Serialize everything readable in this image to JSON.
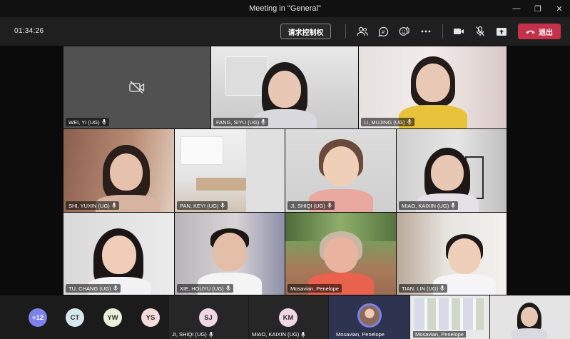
{
  "window": {
    "title": "Meeting in \"General\""
  },
  "toolbar": {
    "timer": "01:34:26",
    "request_control_label": "请求控制权",
    "leave_label": "退出"
  },
  "colors": {
    "leave": "#c4314b",
    "background": "#1f1f1f",
    "avatar_purple": "#7b83eb"
  },
  "participants": [
    {
      "name": "WEI, YI (UG)"
    },
    {
      "name": "FANG, SIYU (UG)"
    },
    {
      "name": "LI, MUJING (UG)"
    },
    {
      "name": "SHI, YUXIN (UG)"
    },
    {
      "name": "PAN, KEYI (UG)"
    },
    {
      "name": "JI, SHIQI (UG)"
    },
    {
      "name": "MIAO, KAIXIN (UG)"
    },
    {
      "name": "TU, CHANG (UG)"
    },
    {
      "name": "XIE, HOUYU (UG)"
    },
    {
      "name": "Mosavian, Penelope"
    },
    {
      "name": "TIAN, LIN (UG)"
    }
  ],
  "strip": {
    "overflow": "+12",
    "avatars": [
      "CT",
      "YW",
      "YS"
    ],
    "tiles": [
      {
        "initials": "SJ",
        "name": "JI, SHIQI (UG)"
      },
      {
        "initials": "KM",
        "name": "MIAO, KAIXIN (UG)"
      },
      {
        "name": "Mosavian, Penelope"
      },
      {
        "name": "Mosavian, Penelope"
      }
    ]
  }
}
